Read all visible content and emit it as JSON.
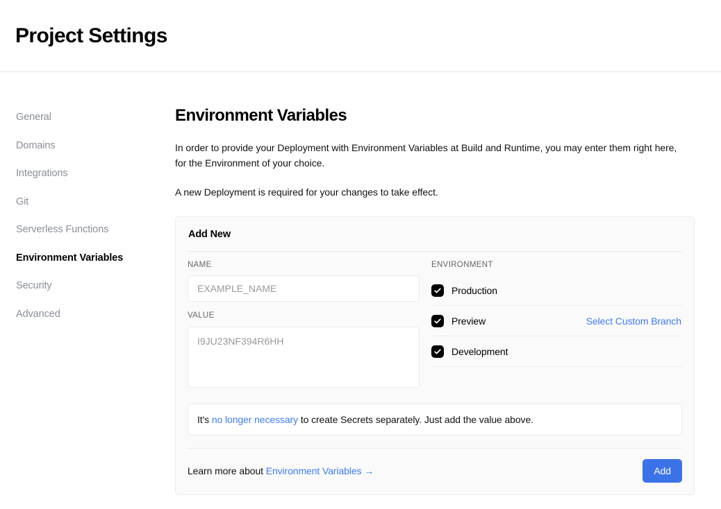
{
  "header": {
    "title": "Project Settings"
  },
  "sidebar": {
    "items": [
      {
        "label": "General",
        "active": false
      },
      {
        "label": "Domains",
        "active": false
      },
      {
        "label": "Integrations",
        "active": false
      },
      {
        "label": "Git",
        "active": false
      },
      {
        "label": "Serverless Functions",
        "active": false
      },
      {
        "label": "Environment Variables",
        "active": true
      },
      {
        "label": "Security",
        "active": false
      },
      {
        "label": "Advanced",
        "active": false
      }
    ]
  },
  "main": {
    "title": "Environment Variables",
    "description_1": "In order to provide your Deployment with Environment Variables at Build and Runtime, you may enter them right here, for the Environment of your choice.",
    "description_2": "A new Deployment is required for your changes to take effect."
  },
  "card": {
    "header_title": "Add New",
    "name_field": {
      "label": "NAME",
      "placeholder": "EXAMPLE_NAME",
      "value": ""
    },
    "value_field": {
      "label": "VALUE",
      "placeholder": "I9JU23NF394R6HH",
      "value": ""
    },
    "environment": {
      "label": "ENVIRONMENT",
      "rows": [
        {
          "label": "Production",
          "checked": true,
          "link": ""
        },
        {
          "label": "Preview",
          "checked": true,
          "link": "Select Custom Branch"
        },
        {
          "label": "Development",
          "checked": true,
          "link": ""
        }
      ]
    },
    "notice": {
      "prefix": "It's ",
      "link": "no longer necessary",
      "suffix": " to create Secrets separately. Just add the value above."
    },
    "footer": {
      "learn_prefix": "Learn more about ",
      "learn_link": "Environment Variables →",
      "add_label": "Add"
    }
  },
  "colors": {
    "link_blue": "#3e7bf0",
    "button_blue": "#3b72e8",
    "checkbox_black": "#000000",
    "border": "#eaeaea",
    "card_bg": "#fafafa",
    "muted_text": "#8a8f98"
  }
}
